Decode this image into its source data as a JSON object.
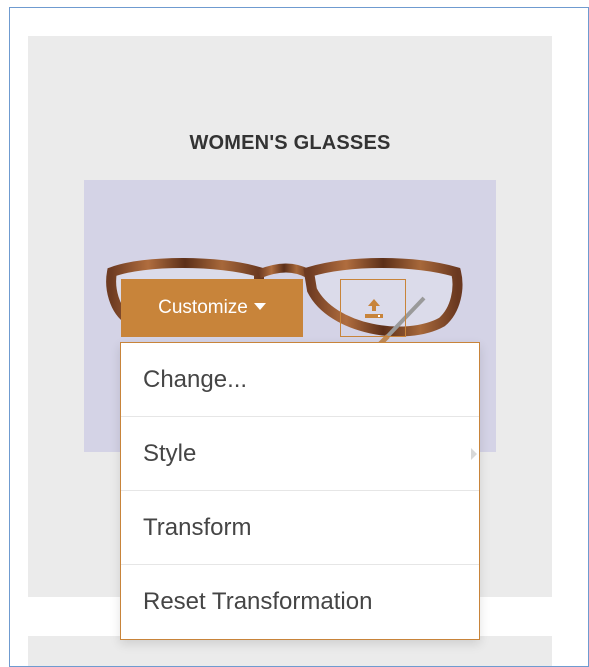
{
  "card": {
    "title": "WOMEN'S GLASSES"
  },
  "toolbar": {
    "customize_label": "Customize",
    "customize_icon": "caret-down-icon",
    "upload_icon": "upload-icon"
  },
  "menu": {
    "items": [
      {
        "label": "Change...",
        "has_submenu": false
      },
      {
        "label": "Style",
        "has_submenu": true
      },
      {
        "label": "Transform",
        "has_submenu": false
      },
      {
        "label": "Reset Transformation",
        "has_submenu": false
      }
    ]
  },
  "colors": {
    "accent": "#c8843a",
    "card_background": "#ebebeb",
    "image_background": "#d4d3e6",
    "frame_border": "#6f9bd0",
    "title_text": "#333333",
    "menu_text": "#454545"
  }
}
